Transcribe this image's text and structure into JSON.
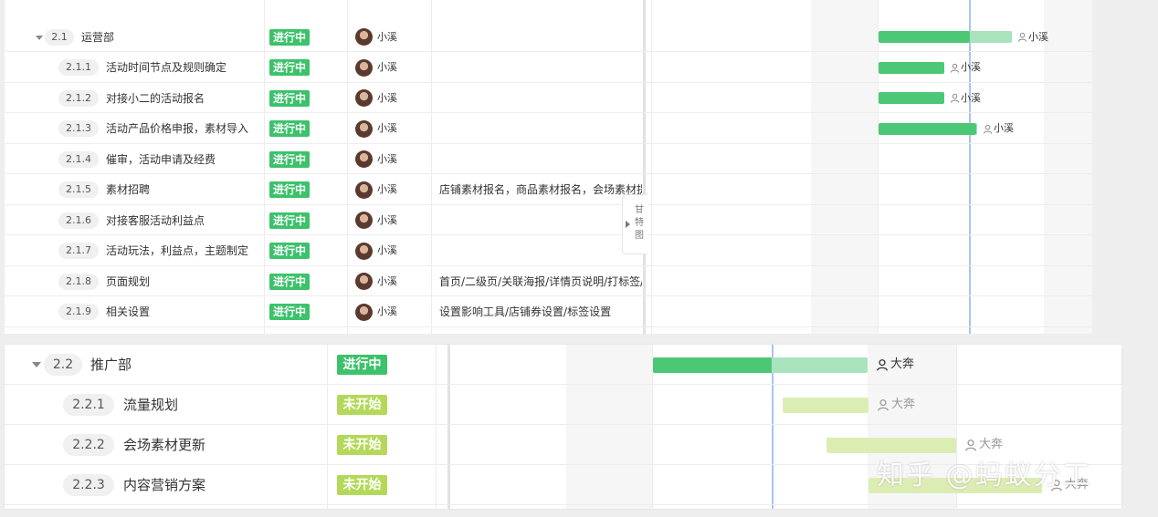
{
  "top_section": {
    "parent": {
      "id": "2.1",
      "name": "运营部",
      "status": "进行中",
      "owner": "小溪",
      "bar_owner": "小溪"
    },
    "tasks": [
      {
        "id": "2.1.1",
        "name": "活动时间节点及规则确定",
        "status": "进行中",
        "owner": "小溪",
        "note": "",
        "bar_owner": "小溪"
      },
      {
        "id": "2.1.2",
        "name": "对接小二的活动报名",
        "status": "进行中",
        "owner": "小溪",
        "note": "",
        "bar_owner": "小溪"
      },
      {
        "id": "2.1.3",
        "name": "活动产品价格申报，素材导入",
        "status": "进行中",
        "owner": "小溪",
        "note": "",
        "bar_owner": "小溪"
      },
      {
        "id": "2.1.4",
        "name": "催审，活动申请及经费",
        "status": "进行中",
        "owner": "小溪",
        "note": ""
      },
      {
        "id": "2.1.5",
        "name": "素材招聘",
        "status": "进行中",
        "owner": "小溪",
        "note": "店铺素材报名，商品素材报名，会场素材提"
      },
      {
        "id": "2.1.6",
        "name": "对接客服活动利益点",
        "status": "进行中",
        "owner": "小溪",
        "note": ""
      },
      {
        "id": "2.1.7",
        "name": "活动玩法，利益点，主题制定",
        "status": "进行中",
        "owner": "小溪",
        "note": ""
      },
      {
        "id": "2.1.8",
        "name": "页面规划",
        "status": "进行中",
        "owner": "小溪",
        "note": "首页/二级页/关联海报/详情页说明/打标签/个"
      },
      {
        "id": "2.1.9",
        "name": "相关设置",
        "status": "进行中",
        "owner": "小溪",
        "note": "设置影响工具/店铺券设置/标签设置"
      }
    ],
    "gantt_tab_label": "甘特图"
  },
  "bottom_section": {
    "parent": {
      "id": "2.2",
      "name": "推广部",
      "status": "进行中",
      "bar_owner": "大奔"
    },
    "tasks": [
      {
        "id": "2.2.1",
        "name": "流量规划",
        "status": "未开始",
        "bar_owner": "大奔"
      },
      {
        "id": "2.2.2",
        "name": "会场素材更新",
        "status": "未开始",
        "bar_owner": "大奔"
      },
      {
        "id": "2.2.3",
        "name": "内容营销方案",
        "status": "未开始",
        "bar_owner": "大奔"
      }
    ]
  },
  "watermark": "知乎 @蚂蚁分工",
  "colors": {
    "in_progress": "#3cc26b",
    "not_started": "#b4d95a",
    "bar_done": "#4cc775",
    "bar_remaining": "#a9e3bd",
    "bar_not_started": "#dcedb4",
    "today_line": "#a9c5ef"
  },
  "icons": {
    "collapse": "caret-down-icon",
    "person": "person-icon",
    "expand": "caret-right-icon"
  }
}
